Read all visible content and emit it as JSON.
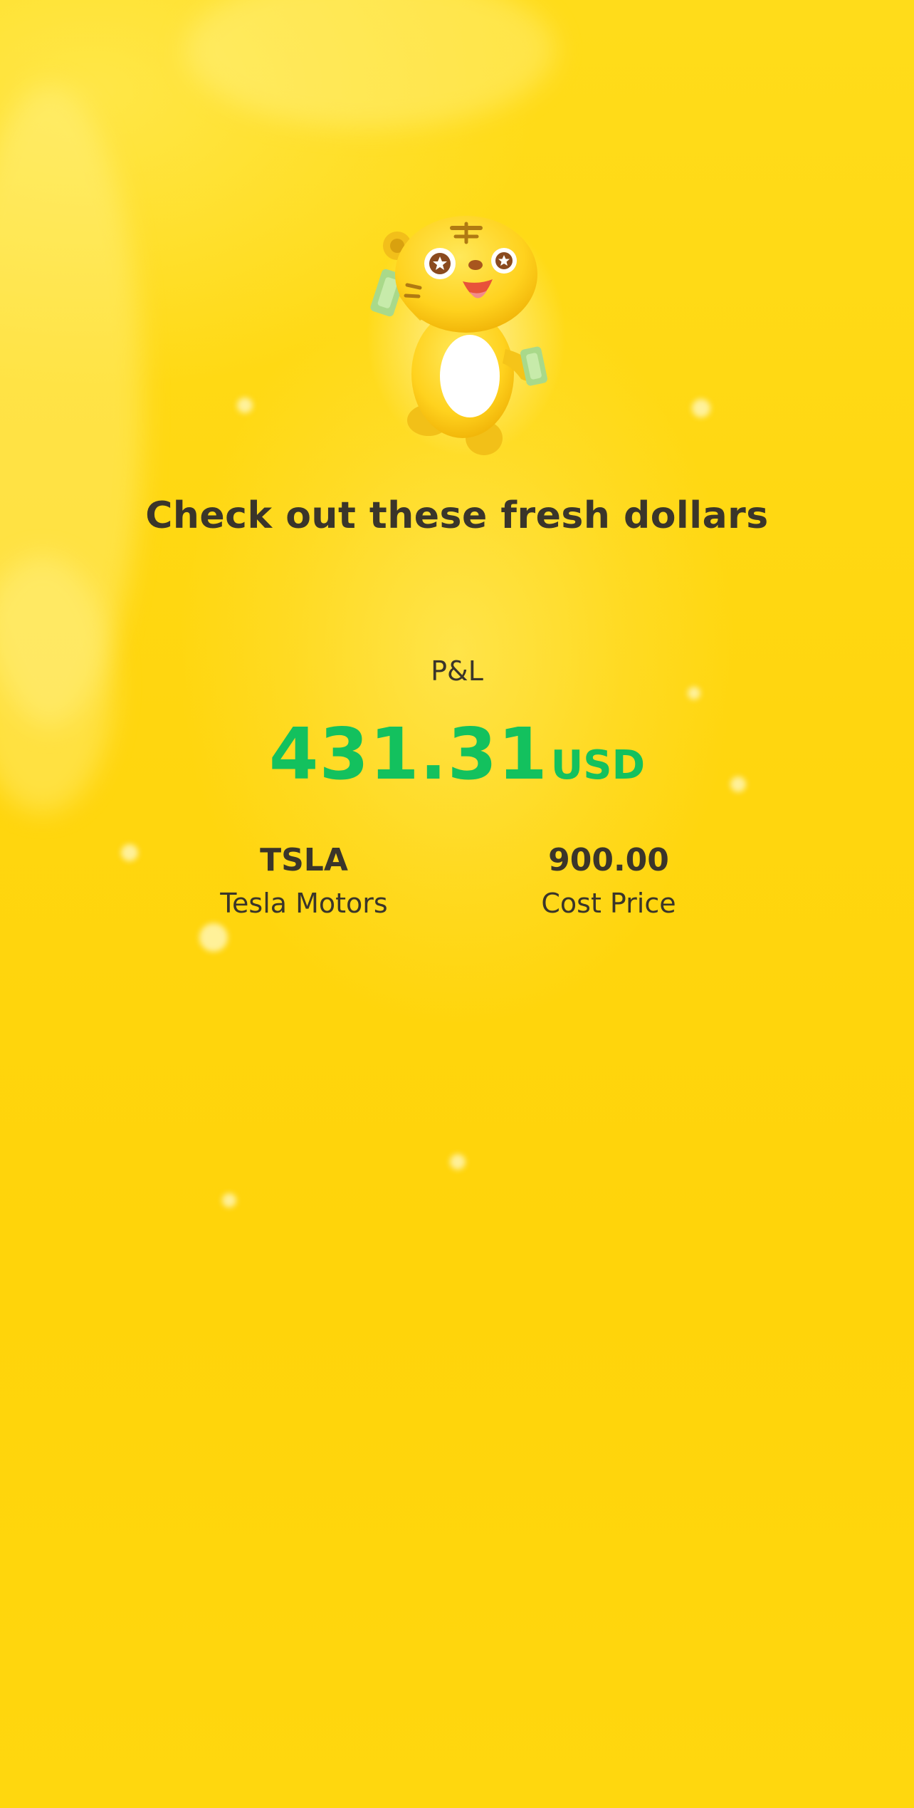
{
  "share_card": {
    "headline": "Check out these fresh dollars",
    "pnl": {
      "label": "P&L",
      "amount": "431.31",
      "currency": "USD",
      "color": "#13C15E"
    },
    "stock": {
      "ticker": "TSLA",
      "name": "Tesla Motors"
    },
    "cost": {
      "value": "900.00",
      "label": "Cost Price"
    },
    "mascot_icon": "tiger-mascot-holding-cash-icon",
    "background_color": "#FFD80A"
  }
}
